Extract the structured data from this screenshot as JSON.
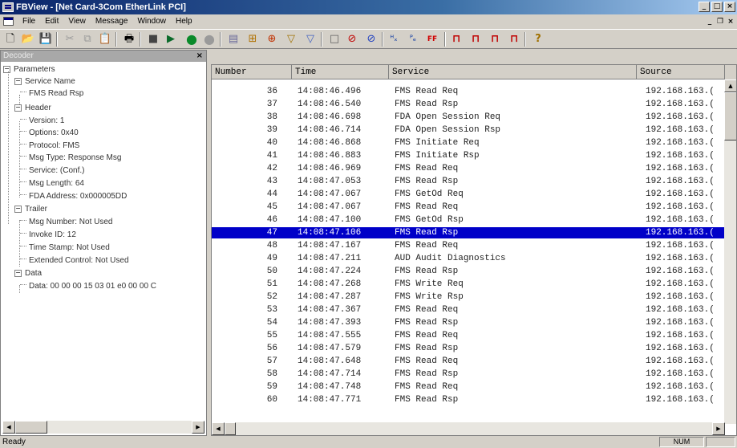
{
  "window": {
    "title": "FBView - [Net Card-3Com EtherLink PCI]",
    "btn_min": "_",
    "btn_max": "□",
    "btn_close": "×"
  },
  "menubar": {
    "items": [
      "File",
      "Edit",
      "View",
      "Message",
      "Window",
      "Help"
    ],
    "mdi_min": "_",
    "mdi_restore": "❐",
    "mdi_close": "×"
  },
  "toolbar": {
    "new": "🗋",
    "open": "📂",
    "save": "💾",
    "cut": "✂",
    "copy": "⧉",
    "paste": "📋",
    "print": "🖶",
    "stop": "■",
    "capture": "▶",
    "record": "●",
    "pause": "●",
    "list": "▤",
    "f1": "⊞",
    "f2": "⊕",
    "f3": "▽",
    "f4": "▽",
    "f5": "□",
    "f6": "⊘",
    "f7": "⊘",
    "fx": "ᴴₓ",
    "fc": "ᴾₑ",
    "ff": "FF",
    "g1": "⊓",
    "g2": "⊓",
    "g3": "⊓",
    "g4": "⊓",
    "help": "?"
  },
  "decoder": {
    "title": "Decoder",
    "close": "×",
    "tree": {
      "root": "Parameters",
      "service_name": "Service Name",
      "service_value": "FMS Read Rsp",
      "header": "Header",
      "header_items": [
        "Version: 1",
        "Options: 0x40",
        "Protocol: FMS",
        "Msg Type: Response Msg",
        "Service: (Conf.)",
        "Msg Length: 64",
        "FDA Address: 0x000005DD"
      ],
      "trailer": "Trailer",
      "trailer_items": [
        "Msg Number: Not Used",
        "Invoke ID: 12",
        "Time Stamp: Not Used",
        "Extended Control: Not Used"
      ],
      "data": "Data",
      "data_items": [
        "Data:  00 00 00 15 03 01 e0 00 00 C"
      ]
    }
  },
  "messages": {
    "columns": [
      "Number",
      "Time",
      "Service",
      "Source"
    ],
    "selected_number": "47",
    "rows": [
      {
        "num": "36",
        "time": "14:08:46.496",
        "service": "FMS Read Req",
        "source": "192.168.163.("
      },
      {
        "num": "37",
        "time": "14:08:46.540",
        "service": "FMS Read Rsp",
        "source": "192.168.163.("
      },
      {
        "num": "38",
        "time": "14:08:46.698",
        "service": "FDA Open Session Req",
        "source": "192.168.163.("
      },
      {
        "num": "39",
        "time": "14:08:46.714",
        "service": "FDA Open Session Rsp",
        "source": "192.168.163.("
      },
      {
        "num": "40",
        "time": "14:08:46.868",
        "service": "FMS Initiate Req",
        "source": "192.168.163.("
      },
      {
        "num": "41",
        "time": "14:08:46.883",
        "service": "FMS Initiate Rsp",
        "source": "192.168.163.("
      },
      {
        "num": "42",
        "time": "14:08:46.969",
        "service": "FMS Read Req",
        "source": "192.168.163.("
      },
      {
        "num": "43",
        "time": "14:08:47.053",
        "service": "FMS Read Rsp",
        "source": "192.168.163.("
      },
      {
        "num": "44",
        "time": "14:08:47.067",
        "service": "FMS GetOd Req",
        "source": "192.168.163.("
      },
      {
        "num": "45",
        "time": "14:08:47.067",
        "service": "FMS Read Req",
        "source": "192.168.163.("
      },
      {
        "num": "46",
        "time": "14:08:47.100",
        "service": "FMS GetOd Rsp",
        "source": "192.168.163.("
      },
      {
        "num": "47",
        "time": "14:08:47.106",
        "service": "FMS Read Rsp",
        "source": "192.168.163.("
      },
      {
        "num": "48",
        "time": "14:08:47.167",
        "service": "FMS Read Req",
        "source": "192.168.163.("
      },
      {
        "num": "49",
        "time": "14:08:47.211",
        "service": "AUD Audit Diagnostics",
        "source": "192.168.163.("
      },
      {
        "num": "50",
        "time": "14:08:47.224",
        "service": "FMS Read Rsp",
        "source": "192.168.163.("
      },
      {
        "num": "51",
        "time": "14:08:47.268",
        "service": "FMS Write Req",
        "source": "192.168.163.("
      },
      {
        "num": "52",
        "time": "14:08:47.287",
        "service": "FMS Write Rsp",
        "source": "192.168.163.("
      },
      {
        "num": "53",
        "time": "14:08:47.367",
        "service": "FMS Read Req",
        "source": "192.168.163.("
      },
      {
        "num": "54",
        "time": "14:08:47.393",
        "service": "FMS Read Rsp",
        "source": "192.168.163.("
      },
      {
        "num": "55",
        "time": "14:08:47.555",
        "service": "FMS Read Req",
        "source": "192.168.163.("
      },
      {
        "num": "56",
        "time": "14:08:47.579",
        "service": "FMS Read Rsp",
        "source": "192.168.163.("
      },
      {
        "num": "57",
        "time": "14:08:47.648",
        "service": "FMS Read Req",
        "source": "192.168.163.("
      },
      {
        "num": "58",
        "time": "14:08:47.714",
        "service": "FMS Read Rsp",
        "source": "192.168.163.("
      },
      {
        "num": "59",
        "time": "14:08:47.748",
        "service": "FMS Read Req",
        "source": "192.168.163.("
      },
      {
        "num": "60",
        "time": "14:08:47.771",
        "service": "FMS Read Rsp",
        "source": "192.168.163.("
      }
    ]
  },
  "scroll": {
    "left": "◀",
    "right": "▶",
    "up": "▲"
  },
  "status": {
    "text": "Ready",
    "num": "NUM",
    "extra": ""
  },
  "colors": {
    "title_start": "#0a246a",
    "title_end": "#a6caf0",
    "selection": "#0000c8",
    "chrome": "#d4d0c8"
  },
  "icons": [
    "app-icon",
    "new-icon",
    "open-icon",
    "save-icon",
    "cut-icon",
    "copy-icon",
    "paste-icon",
    "print-icon",
    "stop-icon",
    "capture-icon",
    "record-icon",
    "pause-icon",
    "help-icon"
  ]
}
